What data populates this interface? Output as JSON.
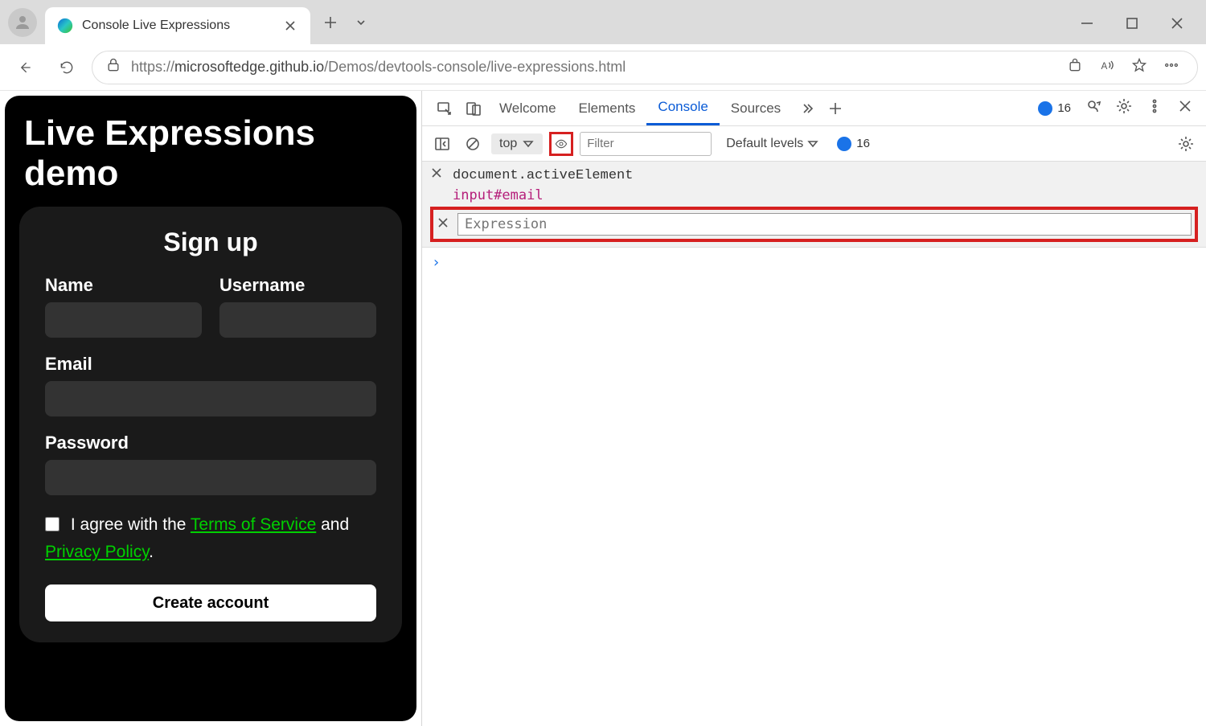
{
  "browser": {
    "tab_title": "Console Live Expressions",
    "url_prefix": "https://",
    "url_host": "microsoftedge.github.io",
    "url_path": "/Demos/devtools-console/live-expressions.html"
  },
  "page": {
    "heading": "Live Expressions demo",
    "form_title": "Sign up",
    "name_label": "Name",
    "username_label": "Username",
    "email_label": "Email",
    "password_label": "Password",
    "agree_prefix": "I agree with the ",
    "tos_link": "Terms of Service",
    "agree_mid": " and ",
    "privacy_link": "Privacy Policy",
    "agree_suffix": ".",
    "create_button": "Create account"
  },
  "devtools": {
    "tabs": {
      "welcome": "Welcome",
      "elements": "Elements",
      "console": "Console",
      "sources": "Sources"
    },
    "issues_count": "16",
    "toolbar": {
      "context": "top",
      "filter_placeholder": "Filter",
      "levels": "Default levels",
      "issues_count": "16"
    },
    "live_expression": {
      "expression": "document.activeElement",
      "value": "input#email"
    },
    "new_expression_placeholder": "Expression",
    "prompt": "›"
  }
}
